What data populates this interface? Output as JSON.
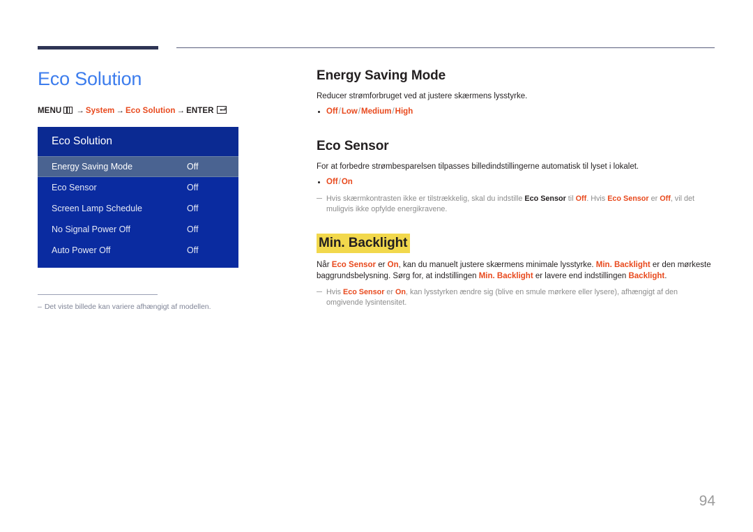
{
  "document": {
    "page_number": "94"
  },
  "left": {
    "title": "Eco Solution",
    "breadcrumb": {
      "menu_label": "MENU",
      "menu_icon": "menu-icon",
      "arrow": "→",
      "crumb1": "System",
      "crumb2": "Eco Solution",
      "enter_label": "ENTER",
      "enter_icon": "enter-icon"
    },
    "osd": {
      "header": "Eco Solution",
      "rows": [
        {
          "label": "Energy Saving Mode",
          "value": "Off",
          "selected": true
        },
        {
          "label": "Eco Sensor",
          "value": "Off",
          "selected": false
        },
        {
          "label": "Screen Lamp Schedule",
          "value": "Off",
          "selected": false
        },
        {
          "label": "No Signal Power Off",
          "value": "Off",
          "selected": false
        },
        {
          "label": "Auto Power Off",
          "value": "Off",
          "selected": false
        }
      ]
    },
    "footnote": {
      "dash": "–",
      "text": "Det viste billede kan variere afhængigt af modellen."
    }
  },
  "right": {
    "sections": [
      {
        "heading": "Energy Saving Mode",
        "highlighted": false,
        "body": "Reducer strømforbruget ved at justere skærmens lysstyrke.",
        "options": [
          "Off",
          "Low",
          "Medium",
          "High"
        ],
        "separator": "/"
      },
      {
        "heading": "Eco Sensor",
        "highlighted": false,
        "body": "For at forbedre strømbesparelsen tilpasses billedindstillingerne automatisk til lyset i lokalet.",
        "options": [
          "Off",
          "On"
        ],
        "separator": "/",
        "note": {
          "p1": "Hvis skærmkontrasten ikke er tilstrækkelig, skal du indstille ",
          "k1": "Eco Sensor",
          "p2": " til ",
          "k2": "Off",
          "p3": ". Hvis ",
          "k3": "Eco Sensor",
          "p4": " er ",
          "k4": "Off",
          "p5": ", vil det muligvis ikke opfylde energikravene."
        }
      },
      {
        "heading": "Min. Backlight",
        "highlighted": true,
        "body_rich": {
          "p1": "Når ",
          "k1": "Eco Sensor",
          "p2": " er ",
          "k2": "On",
          "p3": ", kan du manuelt justere skærmens minimale lysstyrke. ",
          "k3": "Min. Backlight",
          "p4": " er den mørkeste baggrundsbelysning. Sørg for, at indstillingen ",
          "k4": "Min. Backlight",
          "p5": " er lavere end indstillingen ",
          "k5": "Backlight",
          "p6": "."
        },
        "note": {
          "p1": "Hvis ",
          "k1": "Eco Sensor",
          "p2": " er ",
          "k2": "On",
          "p3": ", kan lysstyrken ændre sig (blive en smule mørkere eller lysere), afhængigt af den omgivende lysintensitet."
        }
      }
    ]
  },
  "colors": {
    "title_blue": "#3d7ded",
    "accent_orange": "#e8491d",
    "osd_blue": "#0a2ba0",
    "osd_header_blue": "#0b2a92",
    "osd_selected": "#4a6391",
    "highlight_yellow": "#f2d84c",
    "rule_navy": "#2f3555"
  }
}
